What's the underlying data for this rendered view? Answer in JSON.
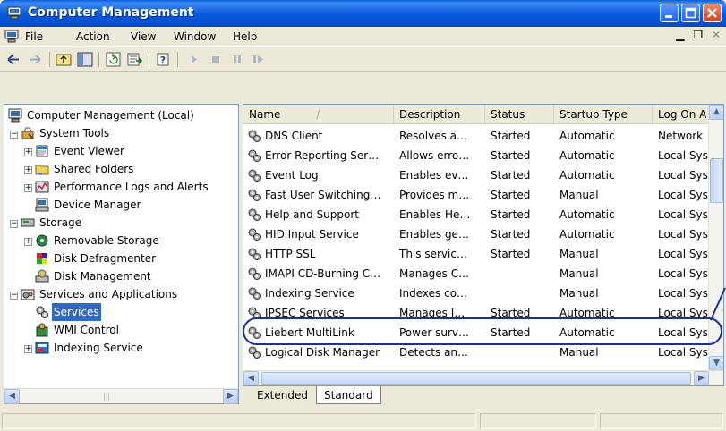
{
  "window": {
    "title": "Computer Management"
  },
  "menu": {
    "items": [
      "File",
      "Action",
      "View",
      "Window",
      "Help"
    ]
  },
  "tree": {
    "items": [
      {
        "label": "Computer Management (Local)",
        "icon": "computer-icon",
        "selected": false
      },
      {
        "label": "System Tools",
        "icon": "tools-icon",
        "selected": false
      },
      {
        "label": "Event Viewer",
        "icon": "event-viewer-icon",
        "selected": false
      },
      {
        "label": "Shared Folders",
        "icon": "folder-icon",
        "selected": false
      },
      {
        "label": "Performance Logs and Alerts",
        "icon": "performance-icon",
        "selected": false
      },
      {
        "label": "Device Manager",
        "icon": "device-manager-icon",
        "selected": false
      },
      {
        "label": "Storage",
        "icon": "storage-icon",
        "selected": false
      },
      {
        "label": "Removable Storage",
        "icon": "removable-storage-icon",
        "selected": false
      },
      {
        "label": "Disk Defragmenter",
        "icon": "defrag-icon",
        "selected": false
      },
      {
        "label": "Disk Management",
        "icon": "disk-management-icon",
        "selected": false
      },
      {
        "label": "Services and Applications",
        "icon": "services-apps-icon",
        "selected": false
      },
      {
        "label": "Services",
        "icon": "services-icon",
        "selected": true
      },
      {
        "label": "WMI Control",
        "icon": "wmi-icon",
        "selected": false
      },
      {
        "label": "Indexing Service",
        "icon": "indexing-icon",
        "selected": false
      }
    ]
  },
  "list": {
    "columns": [
      "Name",
      "Description",
      "Status",
      "Startup Type",
      "Log On A"
    ],
    "sort_indicator": "/",
    "rows": [
      [
        "DNS Client",
        "Resolves a…",
        "Started",
        "Automatic",
        "Network"
      ],
      [
        "Error Reporting Ser…",
        "Allows erro…",
        "Started",
        "Automatic",
        "Local Sys"
      ],
      [
        "Event Log",
        "Enables ev…",
        "Started",
        "Automatic",
        "Local Sys"
      ],
      [
        "Fast User Switching…",
        "Provides m…",
        "Started",
        "Manual",
        "Local Sys"
      ],
      [
        "Help and Support",
        "Enables He…",
        "Started",
        "Automatic",
        "Local Sys"
      ],
      [
        "HID Input Service",
        "Enables ge…",
        "Started",
        "Automatic",
        "Local Sys"
      ],
      [
        "HTTP SSL",
        "This servic…",
        "Started",
        "Manual",
        "Local Sys"
      ],
      [
        "IMAPI CD-Burning C…",
        "Manages C…",
        "",
        "Manual",
        "Local Sys"
      ],
      [
        "Indexing Service",
        "Indexes co…",
        "",
        "Manual",
        "Local Sys"
      ],
      [
        "IPSEC Services",
        "Manages I…",
        "Started",
        "Automatic",
        "Local Sys"
      ],
      [
        "Liebert MultiLink",
        "Power surv…",
        "Started",
        "Automatic",
        "Local Sys"
      ],
      [
        "Logical Disk Manager",
        "Detects an…",
        "",
        "Manual",
        "Local Sys"
      ]
    ],
    "highlighted_row": "Liebert MultiLink"
  },
  "tabs": [
    "Extended",
    "Standard"
  ],
  "active_tab": "Standard",
  "colors": {
    "titlebar": "#0a5fd8",
    "selection": "#316ac5",
    "highlight_ring": "#1a2fa5"
  }
}
